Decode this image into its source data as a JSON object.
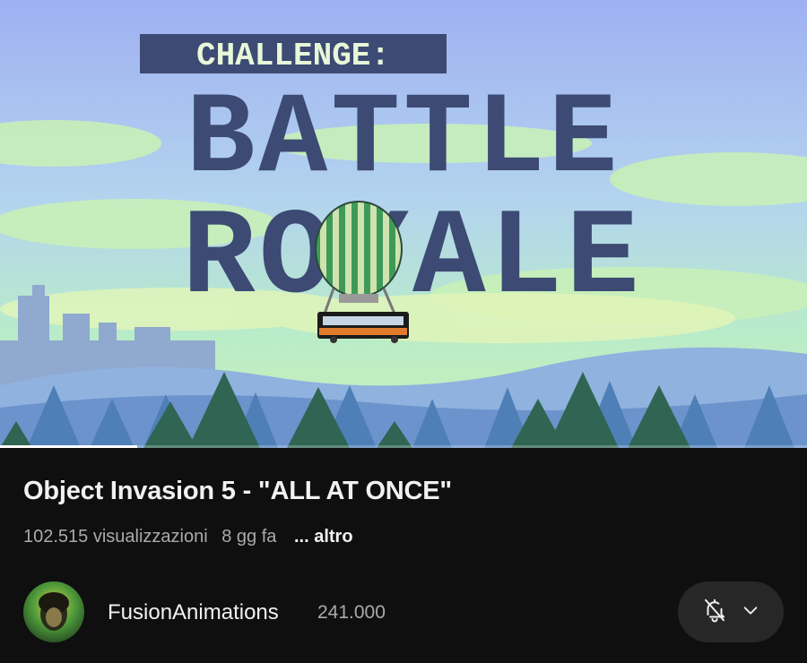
{
  "video": {
    "thumbnail_title_small": "CHALLENGE:",
    "thumbnail_title_line1": "BATTLE",
    "thumbnail_title_line2": "ROYALE",
    "progress_fraction": 0.17
  },
  "info": {
    "title": "Object Invasion 5 - \"ALL AT ONCE\"",
    "views": "102.515 visualizzazioni",
    "age": "8 gg fa",
    "more_label": "... altro"
  },
  "channel": {
    "name": "FusionAnimations",
    "subscribers": "241.000",
    "avatar_icon": "avatar-portrait",
    "bell_icon": "bell-off-icon",
    "chevron_icon": "chevron-down-icon"
  },
  "colors": {
    "background": "#0f0f0f",
    "button_bg": "#272727",
    "title_text": "#f1f1f1",
    "secondary_text": "#aaaaaa",
    "thumbnail_letters": "#3c4a74"
  }
}
